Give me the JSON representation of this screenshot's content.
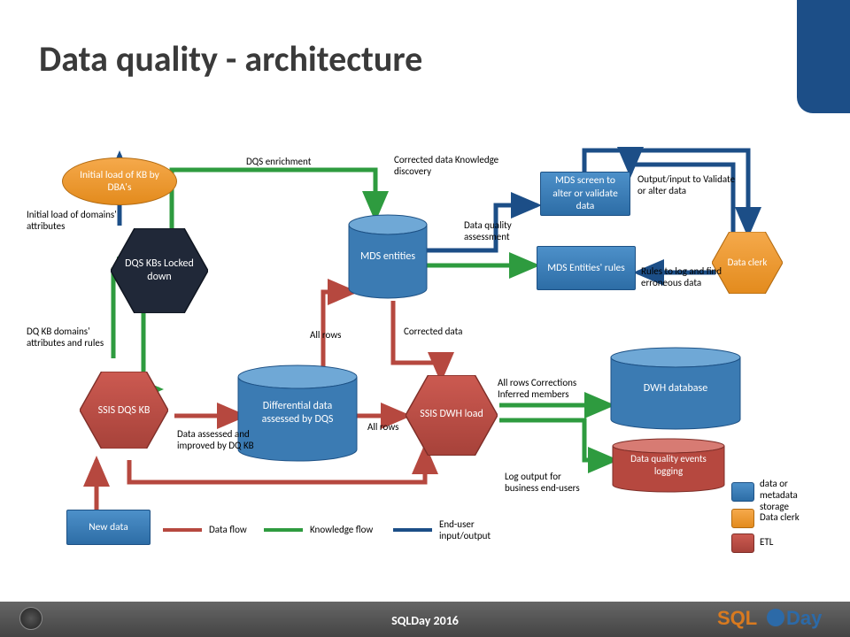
{
  "slide": {
    "title": "Data quality - architecture",
    "footer": "SQLDay 2016",
    "logo_left": "SQL",
    "logo_right": "Day"
  },
  "nodes": {
    "initial_load": "Initial load of KB by DBA's",
    "dqs_kbs": "DQS KBs Locked down",
    "ssis_dqs_kb": "SSIS DQS KB",
    "new_data": "New data",
    "diff_data": "Differential data assessed by DQS",
    "mds_entities": "MDS entities",
    "ssis_dwh_load": "SSIS DWH load",
    "mds_screen": "MDS screen to alter or validate data",
    "mds_rules": "MDS Entities' rules",
    "data_clerk": "Data clerk",
    "dwh_db": "DWH database",
    "dq_events": "Data quality events logging"
  },
  "annotations": {
    "initial_load_domains": "Initial load of domains' attributes",
    "dq_kb_domains": "DQ KB domains' attributes and rules",
    "data_assessed": "Data assessed and improved by DQ KB",
    "dqs_enrichment": "DQS enrichment",
    "corrected_discovery": "Corrected data Knowledge discovery",
    "all_rows_1": "All rows",
    "all_rows_2": "All rows",
    "corrected_data": "Corrected data",
    "data_quality_assessment": "Data quality assessment",
    "output_input": "Output/input to Validate or alter data",
    "rules_to_log": "Rules to log and find erroneous data",
    "all_rows_corrections": "All rows Corrections Inferred members",
    "log_output": "Log output for business end-users"
  },
  "legend": {
    "data_flow": "Data flow",
    "knowledge_flow": "Knowledge flow",
    "end_user": "End-user input/output",
    "data_storage": "data or metadata storage",
    "data_clerk": "Data clerk",
    "etl": "ETL"
  },
  "colors": {
    "red": "#b6483f",
    "green": "#2e9b3f",
    "navy": "#1c4e87",
    "blue": "#3b7bb3",
    "orange": "#e38b1d",
    "dark": "#202838"
  }
}
